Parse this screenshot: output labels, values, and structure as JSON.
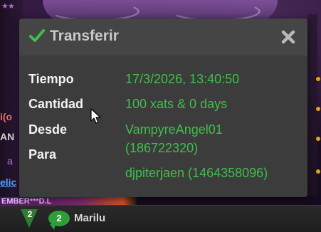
{
  "dialog": {
    "title": "Transferir",
    "rows": [
      {
        "label": "Tiempo",
        "value": "17/3/2026, 13:40:50"
      },
      {
        "label": "Cantidad",
        "value": "100 xats & 0 days"
      },
      {
        "label": "Desde",
        "value": "VampyreAngel01"
      },
      {
        "label": "Para",
        "value": "(186722320)"
      },
      {
        "label": "",
        "value": "djpiterjaen (1464358096)"
      }
    ],
    "icons": {
      "title": "checkmark-icon",
      "close": "close-icon"
    }
  },
  "background": {
    "left_fragments": [
      "i(o",
      "AN",
      "a",
      "elic"
    ],
    "member_strip": "EMBER***D.L",
    "badges": {
      "triangle": "2",
      "bubble": "2"
    },
    "user_name": "Marilu"
  },
  "colors": {
    "dialog_bg": "#3c3c3c",
    "header_bg": "#454545",
    "value_green": "#3fbf4a",
    "label_white": "#f2f2f2"
  }
}
